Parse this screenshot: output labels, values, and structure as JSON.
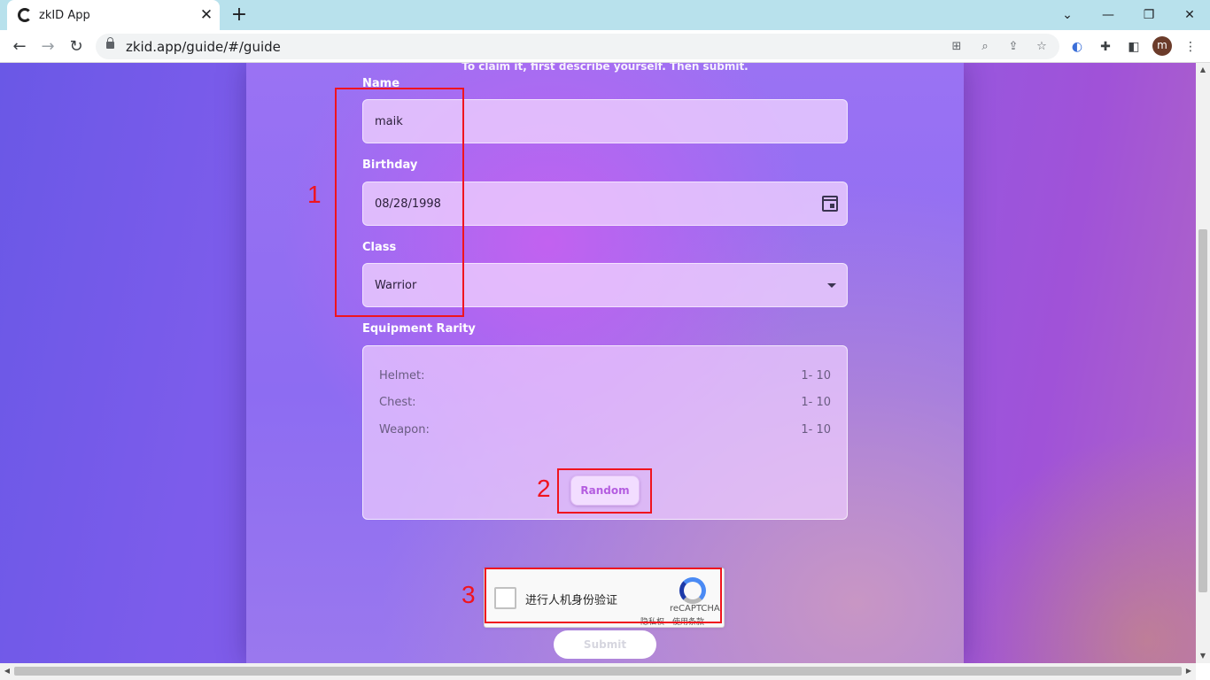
{
  "browser": {
    "tab_title": "zkID App",
    "tab_close": "✕",
    "new_tab": "+",
    "url": "zkid.app/guide/#/guide",
    "profile_initial": "m",
    "window_controls": {
      "minimize": "—",
      "restore": "❐",
      "close": "✕",
      "tab_search": "⌄"
    },
    "nav": {
      "back": "←",
      "forward": "→",
      "reload": "↻"
    }
  },
  "page": {
    "subtitle": "To claim it, first describe yourself. Then submit.",
    "name": {
      "label": "Name",
      "value": "maik"
    },
    "birthday": {
      "label": "Birthday",
      "value": "08/28/1998"
    },
    "class": {
      "label": "Class",
      "value": "Warrior"
    },
    "equipment": {
      "label": "Equipment Rarity",
      "items": [
        {
          "name": "Helmet:",
          "range": "1- 10"
        },
        {
          "name": "Chest:",
          "range": "1- 10"
        },
        {
          "name": "Weapon:",
          "range": "1- 10"
        }
      ],
      "random_label": "Random"
    },
    "recaptcha": {
      "label": "进行人机身份验证",
      "brand": "reCAPTCHA",
      "links": "隐私权 - 使用条款"
    },
    "submit_label": "Submit"
  },
  "annotations": {
    "one": "1",
    "two": "2",
    "three": "3",
    "color": "#f0141e"
  },
  "colors": {
    "tabbar": "#b8e1ec",
    "accent": "#b45de0"
  }
}
